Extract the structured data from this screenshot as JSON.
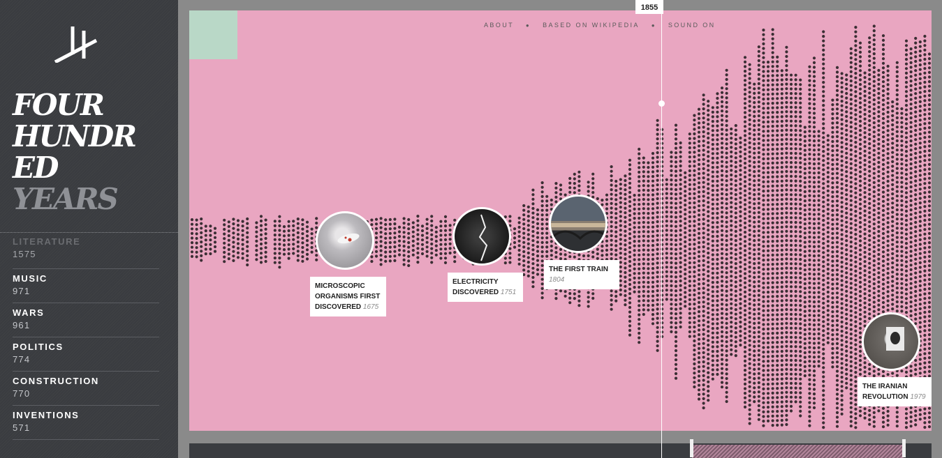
{
  "sidebar": {
    "logo_icon": "H-mark-logo-icon",
    "title_lines": [
      "FOUR",
      "HUNDR",
      "ED",
      "YEARS"
    ],
    "categories": [
      {
        "label": "LITERATURE",
        "count": "1575"
      },
      {
        "label": "MUSIC",
        "count": "971"
      },
      {
        "label": "WARS",
        "count": "961"
      },
      {
        "label": "POLITICS",
        "count": "774"
      },
      {
        "label": "CONSTRUCTION",
        "count": "770"
      },
      {
        "label": "INVENTIONS",
        "count": "571"
      }
    ]
  },
  "top_nav": {
    "about": "ABOUT",
    "based_on": "BASED ON WIKIPEDIA",
    "sound": "SOUND ON",
    "separator": "●"
  },
  "cursor": {
    "year": "1855"
  },
  "events": [
    {
      "title": "MICROSCOPIC ORGANISMS FIRST DISCOVERED",
      "year": "1675",
      "icon": "microscope-photo-icon"
    },
    {
      "title": "ELECTRICITY DISCOVERED",
      "year": "1751",
      "icon": "lightning-photo-icon"
    },
    {
      "title": "THE FIRST TRAIN",
      "year": "1804",
      "icon": "train-bridge-photo-icon"
    },
    {
      "title": "THE IRANIAN REVOLUTION",
      "year": "1979",
      "icon": "crowd-portrait-photo-icon"
    }
  ],
  "colors": {
    "background_pink": "#e9a6c1",
    "corner_mint": "#b9d8c7",
    "dot": "#3b2e34",
    "sidebar": "#3a3c40"
  }
}
